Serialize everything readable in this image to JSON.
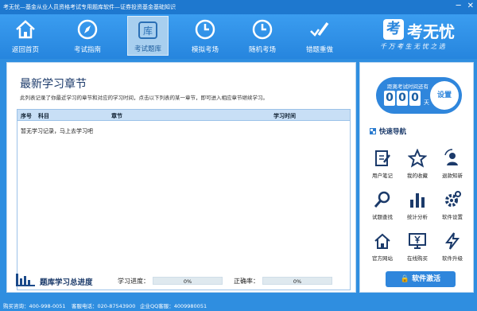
{
  "window": {
    "title": "考无忧—基金从业人员资格考试专用题库软件—证券投资基金基础知识",
    "controls": [
      "─",
      "✕"
    ]
  },
  "toolbar": {
    "items": [
      {
        "label": "返回首页",
        "icon": "home-icon",
        "active": false
      },
      {
        "label": "考试指南",
        "icon": "compass-icon",
        "active": false
      },
      {
        "label": "考试题库",
        "icon": "library-icon",
        "active": true,
        "badge": "库"
      },
      {
        "label": "模拟考场",
        "icon": "clock-icon",
        "active": false
      },
      {
        "label": "随机考场",
        "icon": "clock-icon",
        "active": false
      },
      {
        "label": "错题重做",
        "icon": "pencil-check-icon",
        "active": false
      }
    ]
  },
  "brand": {
    "logo_char": "考",
    "name": "考无忧",
    "slogan": "千 万 考 生   无 忧 之 选"
  },
  "main": {
    "title": "最新学习章节",
    "description": "此列表记录了你最近学习的章节和对应的学习时间，点击以下列表的某一章节，即可进入相应章节继续学习。",
    "columns": [
      "序号",
      "科目",
      "章节",
      "学习时间"
    ],
    "empty_text": "暂无学习记录，马上去学习吧"
  },
  "progress": {
    "title": "题库学习总进度",
    "study_label": "学习进度：",
    "study_value": "0%",
    "study_fraction": 0,
    "accuracy_label": "正确率：",
    "accuracy_value": "0%",
    "accuracy_fraction": 0
  },
  "sidebar": {
    "countdown_label": "距离考试时间还有",
    "digits": [
      "0",
      "0",
      "0"
    ],
    "unit": "天",
    "settings_button": "设置",
    "quick_nav_title": "快速导航",
    "quick_nav": [
      {
        "label": "用户笔记",
        "icon": "note-icon"
      },
      {
        "label": "我的收藏",
        "icon": "star-icon"
      },
      {
        "label": "退款知新",
        "icon": "refresh-user-icon"
      },
      {
        "label": "试题查找",
        "icon": "search-icon"
      },
      {
        "label": "统计分析",
        "icon": "bar-chart-icon"
      },
      {
        "label": "软件设置",
        "icon": "gear-icon"
      },
      {
        "label": "官方网站",
        "icon": "home-outline-icon"
      },
      {
        "label": "在线购买",
        "icon": "monitor-yen-icon"
      },
      {
        "label": "软件升级",
        "icon": "lightning-icon"
      }
    ],
    "activate_button": "软件激活"
  },
  "statusbar": {
    "sales": "购买咨询：400-998-0051",
    "service": "客服电话：020-87543900",
    "qq": "企业QQ客服：4009980051"
  },
  "colors": {
    "accent": "#2f8ee0",
    "active_tab": "#a8cfef",
    "header_row": "#c8dff6"
  }
}
